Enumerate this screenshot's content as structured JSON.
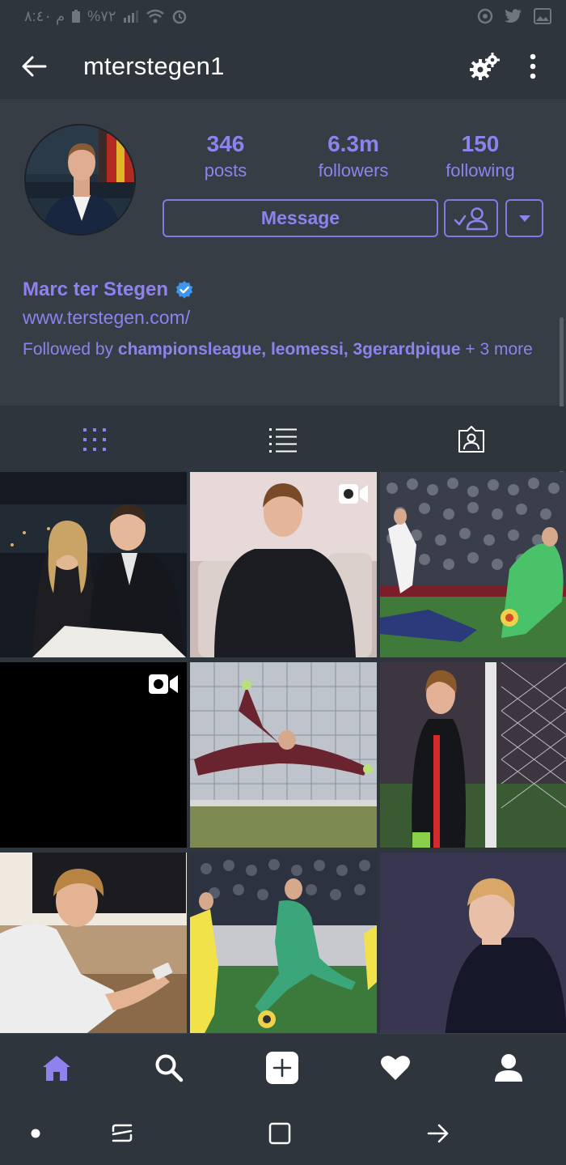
{
  "status_bar": {
    "time_text": "م ٨:٤٠",
    "battery_text": "%٧٢",
    "icons": [
      "battery-icon",
      "signal-icon",
      "wifi-icon",
      "alarm-icon",
      "record-icon",
      "twitter-icon",
      "gallery-icon"
    ]
  },
  "header": {
    "username": "mterstegen1",
    "icons": {
      "back": "arrow-left-icon",
      "settings": "gear-icon",
      "more": "vertical-dots-icon"
    }
  },
  "profile": {
    "stats": [
      {
        "value": "346",
        "label": "posts"
      },
      {
        "value": "6.3m",
        "label": "followers"
      },
      {
        "value": "150",
        "label": "following"
      }
    ],
    "message_label": "Message",
    "full_name": "Marc ter Stegen",
    "verified": true,
    "website": "www.terstegen.com/",
    "followed_by_prefix": "Followed by ",
    "followed_by_users": "championsleague, leomessi, 3gerardpique",
    "followed_by_suffix": " + 3 more",
    "accent_color": "#8f82ee"
  },
  "tabs": [
    {
      "name": "grid-view",
      "icon": "grid-icon",
      "active": true
    },
    {
      "name": "list-view",
      "icon": "list-icon",
      "active": false
    },
    {
      "name": "tagged",
      "icon": "tagged-person-icon",
      "active": false
    }
  ],
  "posts": [
    {
      "kind": "photo",
      "video": false
    },
    {
      "kind": "video",
      "video": true
    },
    {
      "kind": "photo",
      "video": false
    },
    {
      "kind": "video",
      "video": true
    },
    {
      "kind": "photo",
      "video": false
    },
    {
      "kind": "photo",
      "video": false
    },
    {
      "kind": "photo",
      "video": false
    },
    {
      "kind": "photo",
      "video": false
    },
    {
      "kind": "photo",
      "video": false
    }
  ],
  "bottom_nav": [
    {
      "icon": "home-icon",
      "active": true
    },
    {
      "icon": "search-icon",
      "active": false
    },
    {
      "icon": "add-post-icon",
      "active": false
    },
    {
      "icon": "heart-icon",
      "active": false
    },
    {
      "icon": "profile-icon",
      "active": false
    }
  ],
  "system_nav": [
    "dot-icon",
    "recent-apps-icon",
    "home-square-icon",
    "back-arrow-icon"
  ]
}
